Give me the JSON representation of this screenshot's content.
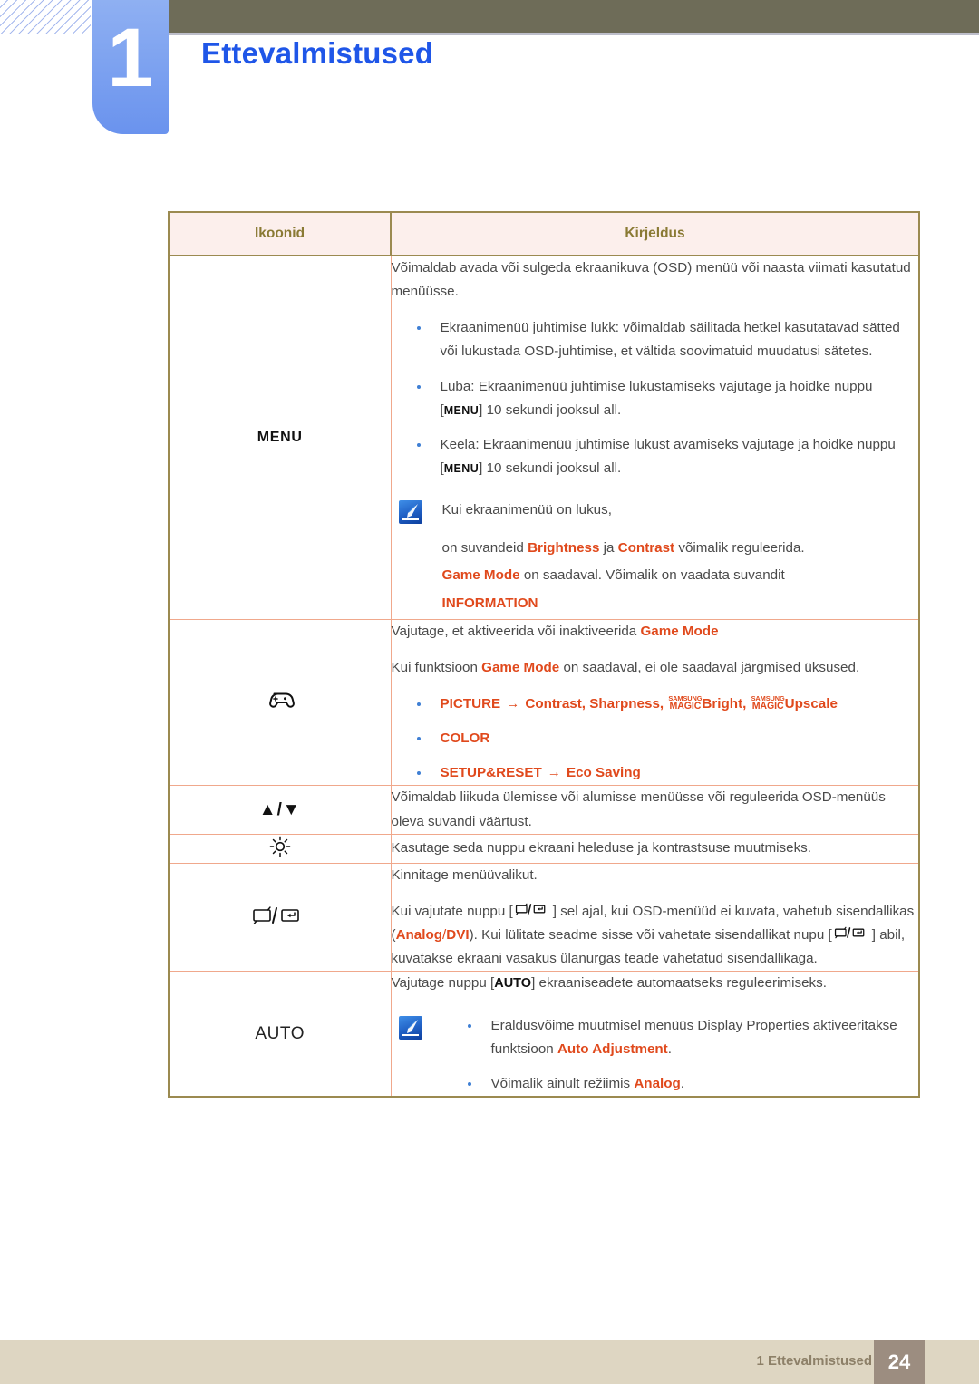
{
  "header": {
    "chapter_number": "1",
    "title": "Ettevalmistused"
  },
  "table": {
    "columns": [
      "Ikoonid",
      "Kirjeldus"
    ],
    "rows": [
      {
        "icon_label": "MENU",
        "icon_kind": "text",
        "desc": {
          "intro": "Võimaldab avada või sulgeda ekraanikuva (OSD) menüü või naasta viimati kasutatud menüüsse.",
          "bullets": [
            "Ekraanimenüü juhtimise lukk: võimaldab säilitada hetkel kasutatavad sätted või lukustada OSD-juhtimise, et vältida soovimatuid muudatusi sätetes.",
            "Luba: Ekraanimenüü juhtimise lukustamiseks vajutage ja hoidke nuppu [MENU] 10 sekundi jooksul all.",
            "Keela: Ekraanimenüü juhtimise lukust avamiseks vajutage ja hoidke nuppu [MENU] 10 sekundi jooksul all."
          ],
          "bullet_kbd": "MENU",
          "note": {
            "line1": "Kui ekraanimenüü on lukus,",
            "line2_a": "on suvandeid ",
            "line2_b": "Brightness",
            "line2_c": " ja ",
            "line2_d": "Contrast",
            "line2_e": " võimalik reguleerida.",
            "line3_a": "Game Mode",
            "line3_b": " on saadaval. Võimalik on vaadata suvandit",
            "line4": "INFORMATION"
          }
        }
      },
      {
        "icon_label": "gamepad-icon",
        "icon_kind": "gamepad",
        "desc": {
          "line1_a": "Vajutage, et aktiveerida või inaktiveerida ",
          "line1_b": "Game Mode",
          "line2_a": "Kui funktsioon ",
          "line2_b": "Game Mode",
          "line2_c": " on saadaval, ei ole saadaval järgmised üksused.",
          "bullets": [
            {
              "head": "PICTURE",
              "arrow": "→",
              "rest": "Contrast, Sharpness, ",
              "magic1_top": "SAMSUNG",
              "magic1_bot": "MAGIC",
              "magic1_word": "Bright, ",
              "magic2_top": "SAMSUNG",
              "magic2_bot": "MAGIC",
              "magic2_word": "Upscale"
            },
            {
              "head": "COLOR",
              "arrow": "",
              "rest": ""
            },
            {
              "head": "SETUP&RESET",
              "arrow": "→",
              "rest": "Eco Saving"
            }
          ]
        }
      },
      {
        "icon_label": "▲/▼",
        "icon_kind": "updown",
        "desc": {
          "text": "Võimaldab liikuda ülemisse või alumisse menüüsse või reguleerida OSD-menüüs oleva suvandi väärtust."
        }
      },
      {
        "icon_label": "brightness-icon",
        "icon_kind": "brightness",
        "desc": {
          "text": "Kasutage seda nuppu ekraani heleduse ja kontrastsuse muutmiseks."
        }
      },
      {
        "icon_label": "source-enter-icon",
        "icon_kind": "source-enter",
        "desc": {
          "line1": "Kinnitage menüüvalikut.",
          "line2_a": "Kui vajutate nuppu [",
          "line2_b": "] sel ajal, kui OSD-menüüd ei kuvata, vahetub sisendallikas (",
          "line2_c": "Analog",
          "line2_d": "/",
          "line2_e": "DVI",
          "line2_f": "). Kui lülitate seadme sisse või vahetate sisendallikat nupu [",
          "line2_g": "] abil, kuvatakse ekraani vasakus ülanurgas teade vahetatud sisendallikaga."
        }
      },
      {
        "icon_label": "AUTO",
        "icon_kind": "text-auto",
        "desc": {
          "line1_a": "Vajutage nuppu [",
          "line1_kbd": "AUTO",
          "line1_b": "] ekraaniseadete automaatseks reguleerimiseks.",
          "note_bullets": [
            {
              "a": "Eraldusvõime muutmisel menüüs Display Properties aktiveeritakse funktsioon ",
              "b": "Auto Adjustment",
              "c": "."
            },
            {
              "a": "Võimalik ainult režiimis ",
              "b": "Analog",
              "c": "."
            }
          ]
        }
      }
    ]
  },
  "footer": {
    "label": "1 Ettevalmistused",
    "page": "24"
  },
  "colors": {
    "title_blue": "#1f56e8",
    "olive_bar": "#6e6c58",
    "table_border": "#9b8a50",
    "table_inner_border": "#f0a88c",
    "header_bg": "#fcefec",
    "header_text": "#8a7a34",
    "accent_orange": "#e0491c",
    "bullet_blue": "#3f7fd4",
    "footer_bg": "#ded6c2",
    "footer_page_bg": "#9c8d80"
  }
}
